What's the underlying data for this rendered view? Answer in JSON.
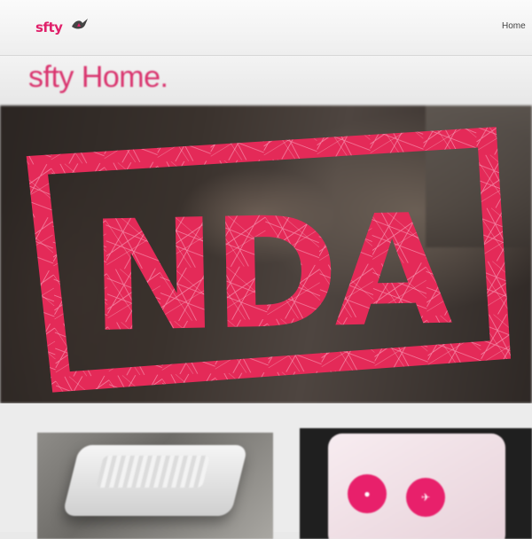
{
  "header": {
    "logo_text": "sfty",
    "nav_partial": "Home"
  },
  "product": {
    "title": "sfty Home."
  },
  "stamp": {
    "text": "NDA",
    "color": "#e8305f"
  },
  "brand": {
    "accent_color": "#e0206a"
  },
  "icons": {
    "logo": "bird-logo-icon",
    "app_button_1": "alarm-icon",
    "app_button_2": "shield-icon"
  }
}
